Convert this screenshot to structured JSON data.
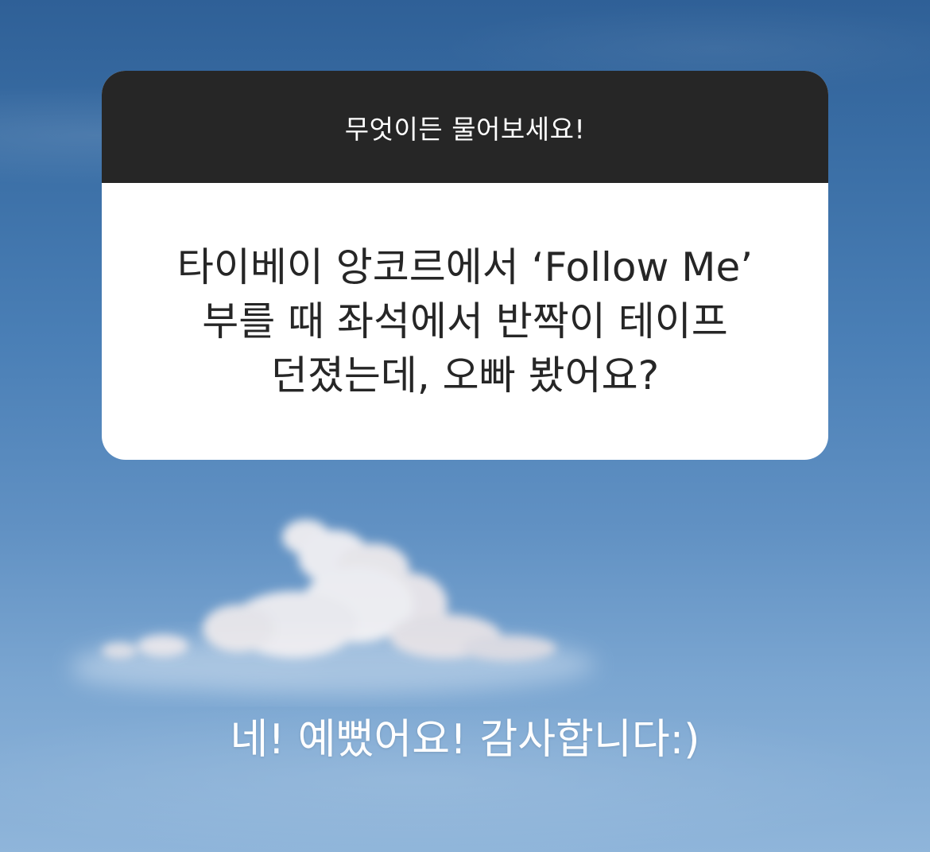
{
  "background": {
    "icon": "sky-with-cloud",
    "colors": {
      "sky_top": "#2f6097",
      "sky_bottom": "#8fb5da",
      "card_header": "#262626",
      "card_body": "#ffffff",
      "question_text": "#262626",
      "answer_text": "#ffffff"
    }
  },
  "question_sticker": {
    "prompt": "무엇이든 물어보세요!",
    "question": "타이베이 앙코르에서 ‘Follow Me’\n부를 때 좌석에서 반짝이 테이프\n던졌는데, 오빠 봤어요?"
  },
  "answer": {
    "text": "네! 예뻤어요! 감사합니다:)"
  }
}
